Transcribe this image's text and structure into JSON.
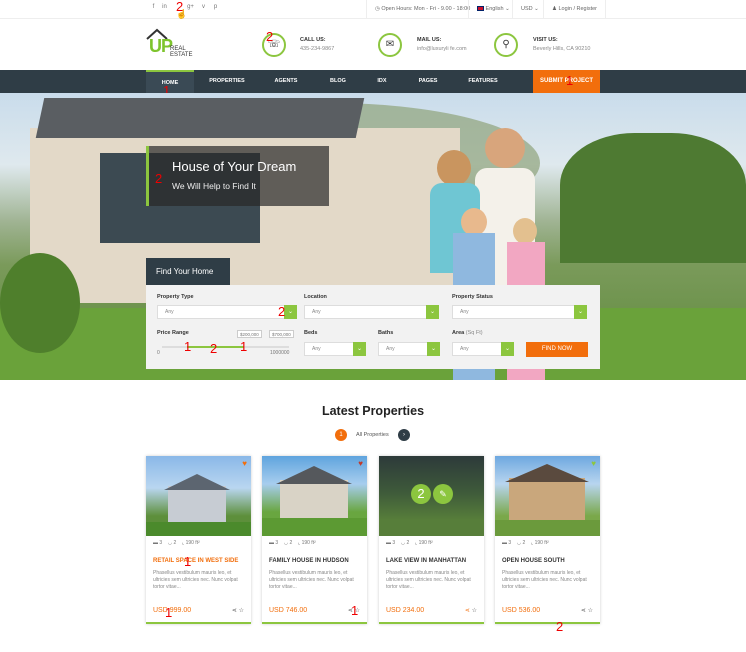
{
  "topbar": {
    "social": [
      "f",
      "in",
      "g+",
      "v",
      "p"
    ],
    "hours": "Open Hours: Mon - Fri - 9.00 - 18:00",
    "language": "English",
    "currency": "USD",
    "login": "Login / Register"
  },
  "header": {
    "logo_main": "UP",
    "logo_sub": "REAL ESTATE",
    "call_label": "CALL US:",
    "call_value": "435-234-9867",
    "mail_label": "MAIL US:",
    "mail_value": "info@luxuryli fe.com",
    "visit_label": "VISIT US:",
    "visit_value": "Beverly Hills, CA 90210"
  },
  "nav": {
    "items": [
      "HOME",
      "PROPERTIES",
      "AGENTS",
      "BLOG",
      "IDX",
      "PAGES",
      "FEATURES"
    ],
    "submit": "SUBMIT PROJECT"
  },
  "hero": {
    "title": "House of Your Dream",
    "subtitle": "We Will Help to Find It"
  },
  "search": {
    "tab": "Find Your Home",
    "type_label": "Property Type",
    "type_value": "Any",
    "location_label": "Location",
    "location_value": "Any",
    "status_label": "Property Status",
    "status_value": "Any",
    "price_label": "Price Range",
    "price_min_box": "$200,000",
    "price_max_box": "$700,000",
    "price_min": "0",
    "price_max": "1000000",
    "beds_label": "Beds",
    "beds_value": "Any",
    "baths_label": "Baths",
    "baths_value": "Any",
    "area_label": "Area",
    "area_unit": "(Sq Ft)",
    "area_value": "Any",
    "button": "FIND NOW"
  },
  "latest": {
    "title": "Latest Properties",
    "tab_all": "All Properties"
  },
  "cards": [
    {
      "beds": "3",
      "baths": "2",
      "area": "190 ft²",
      "title": "RETAIL SPACE IN WEST SIDE",
      "desc": "Phasellus vestibulum mauris leo, et ultricies sem ultricies nec. Nunc volpat tortor vitae...",
      "price": "USD 999.00"
    },
    {
      "beds": "3",
      "baths": "2",
      "area": "190 ft²",
      "title": "FAMILY HOUSE IN HUDSON",
      "desc": "Phasellus vestibulum mauris leo, et ultricies sem ultricies nec. Nunc volpat tortor vitae...",
      "price": "USD 746.00"
    },
    {
      "beds": "3",
      "baths": "2",
      "area": "190 ft²",
      "title": "LAKE VIEW IN MANHATTAN",
      "desc": "Phasellus vestibulum mauris leo, et ultricies sem ultricies nec. Nunc volpat tortor vitae...",
      "price": "USD 234.00"
    },
    {
      "beds": "3",
      "baths": "2",
      "area": "190 ft²",
      "title": "OPEN HOUSE SOUTH",
      "desc": "Phasellus vestibulum mauris leo, et ultricies sem ultricies nec. Nunc volpat tortor vitae...",
      "price": "USD 536.00"
    }
  ],
  "annotations": {
    "a_top_social": "2",
    "a_header_call": "2",
    "a_nav_home": "1",
    "a_nav_submit": "1",
    "a_caption": "2",
    "a_search_type": "2",
    "a_slider_1": "1",
    "a_slider_2": "2",
    "a_slider_3": "1",
    "a_tab_1": "1",
    "a_card1_title": "1",
    "a_card1_price": "1",
    "a_card2_share": "1",
    "a_card3_img": "2",
    "a_card4_bottom": "2"
  },
  "colors": {
    "accent": "#8cc63f",
    "orange": "#f26e0c",
    "nav": "#2f3d46"
  }
}
